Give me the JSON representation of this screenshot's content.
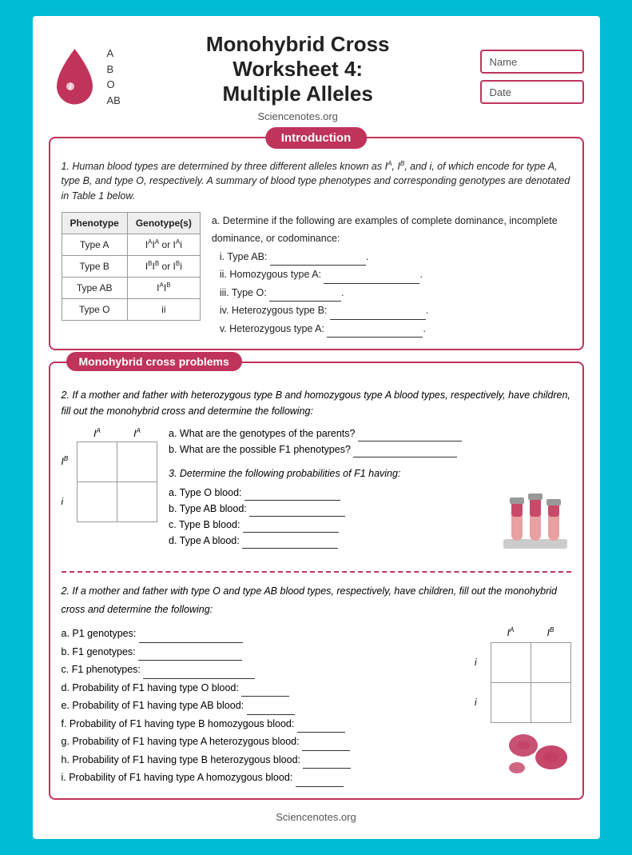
{
  "header": {
    "title_line1": "Monohybrid Cross",
    "title_line2": "Worksheet 4:",
    "title_line3": "Multiple Alleles",
    "website": "Sciencenotes.org",
    "name_label": "Name",
    "date_label": "Date",
    "blood_type_labels": [
      "A",
      "B",
      "O",
      "AB"
    ]
  },
  "intro_section": {
    "header": "Introduction",
    "paragraph": "1. Human blood types are determined by three different alleles known as I",
    "paragraph_full": "1. Human blood types are determined by three different alleles known as IᴬA, IᴮB, and i, of which encode for type A, type B, and type O, respectively. A summary of blood type phenotypes and corresponding genotypes are denotated in Table 1 below.",
    "table": {
      "headers": [
        "Phenotype",
        "Genotype(s)"
      ],
      "rows": [
        [
          "Type A",
          "IᴬIᴬ or Iᴬi"
        ],
        [
          "Type B",
          "IᴮIᴮ or Iᴮi"
        ],
        [
          "Type AB",
          "IᴬIᴮ"
        ],
        [
          "Type O",
          "ii"
        ]
      ]
    },
    "questions_header": "a. Determine if the following are examples of complete dominance, incomplete dominance, or codominance:",
    "questions": [
      "i. Type AB: ___________________.",
      "ii. Homozygous type A: ___________________.",
      "iii. Type O: ________________.",
      "iv. Heterozygous type B: ___________________.",
      "v. Heterozygous type A: ___________________."
    ]
  },
  "monohybrid_section": {
    "header": "Monohybrid cross problems",
    "problem1": {
      "text": "2. If a mother and father with heterozygous type B and homozygous type A blood types, respectively, have children, fill out the monohybrid cross and determine the following:",
      "punnett": {
        "col_headers": [
          "Iᴬ",
          "Iᴬ"
        ],
        "row_headers": [
          "Iᴮ",
          "i"
        ],
        "cells": [
          [
            "",
            ""
          ],
          [
            "",
            ""
          ]
        ]
      },
      "questions": [
        "a. What are the genotypes of the parents? ________________",
        "b. What are the possible F1 phenotypes? ________________"
      ]
    },
    "problem1b": {
      "text": "3. Determine the following probabilities of F1 having:",
      "questions": [
        "a. Type O blood: ____________________",
        "b. Type AB blood: ____________________",
        "c. Type B blood: ____________________",
        "d. Type A blood: ____________________"
      ]
    },
    "problem2": {
      "text": "2. If a mother and father with type O and type AB blood types, respectively, have children, fill out the monohybrid cross and determine the following:",
      "questions": [
        "a. P1 genotypes: ____________________",
        "b. F1 genotypes: ____________________",
        "c. F1 phenotypes: ____________________",
        "d. Probability of F1 having type O blood: _________",
        "e. Probability of F1 having type AB blood: _________",
        "f. Probability of F1 having type B homozygous blood: _________",
        "g. Probability of F1 having type A heterozygous blood: _________",
        "h. Probability of F1 having type B heterozygous blood: _________",
        "i. Probability of F1 having type A homozygous blood: _________"
      ],
      "punnett": {
        "col_headers": [
          "Iᴬ",
          "Iᴮ"
        ],
        "row_headers": [
          "i",
          "i"
        ],
        "cells": [
          [
            "",
            ""
          ],
          [
            "",
            ""
          ]
        ]
      }
    }
  },
  "footer": {
    "text": "Sciencenotes.org"
  }
}
